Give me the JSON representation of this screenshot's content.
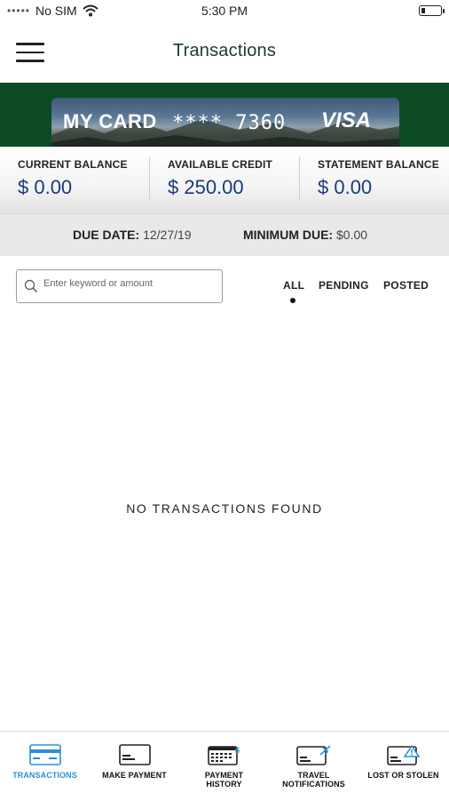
{
  "status_bar": {
    "carrier": "No SIM",
    "time": "5:30 PM"
  },
  "header": {
    "title": "Transactions"
  },
  "card": {
    "name": "MY CARD",
    "number_masked": "**** 7360",
    "brand": "VISA"
  },
  "balances": {
    "current": {
      "label": "CURRENT BALANCE",
      "value": "$ 0.00"
    },
    "available": {
      "label": "AVAILABLE CREDIT",
      "value": "$ 250.00"
    },
    "statement": {
      "label": "STATEMENT BALANCE",
      "value": "$ 0.00"
    }
  },
  "due": {
    "due_date_label": "DUE DATE:",
    "due_date_value": "12/27/19",
    "minimum_due_label": "MINIMUM DUE:",
    "minimum_due_value": "$0.00"
  },
  "search": {
    "placeholder": "Enter keyword or amount"
  },
  "filters": {
    "all": "ALL",
    "pending": "PENDING",
    "posted": "POSTED",
    "selected": "ALL"
  },
  "empty_state": "NO TRANSACTIONS FOUND",
  "tabs": {
    "transactions": {
      "label": "TRANSACTIONS",
      "icon": "card-icon"
    },
    "make_payment": {
      "label": "MAKE PAYMENT",
      "icon": "card-icon"
    },
    "payment_history": {
      "label_line1": "PAYMENT",
      "label_line2": "HISTORY",
      "icon": "calendar-card-icon"
    },
    "travel": {
      "label_line1": "TRAVEL",
      "label_line2": "NOTIFICATIONS",
      "icon": "card-plane-icon"
    },
    "lost_stolen": {
      "label": "LOST OR STOLEN",
      "icon": "card-warning-icon"
    },
    "active": "transactions"
  },
  "colors": {
    "banner_green": "#0c4a26",
    "balance_blue": "#1a3b78",
    "active_tab_blue": "#2b8fd6",
    "title_green": "#1f3a2a"
  }
}
